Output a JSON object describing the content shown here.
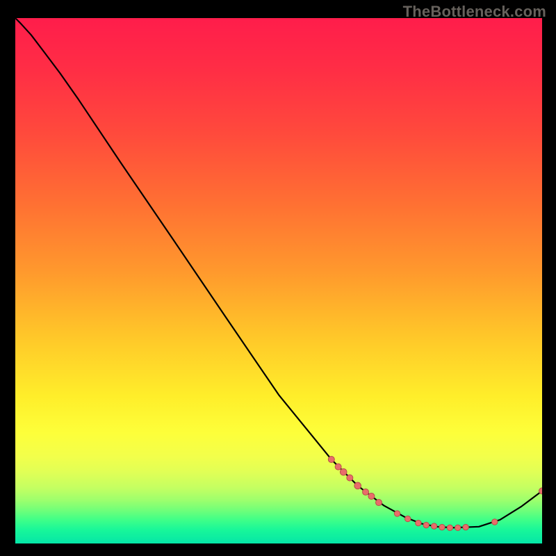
{
  "watermark": "TheBottleneck.com",
  "colors": {
    "marker_fill": "#e86d6a",
    "marker_stroke": "#b85049",
    "curve": "#000000"
  },
  "chart_data": {
    "type": "line",
    "title": "",
    "xlabel": "",
    "ylabel": "",
    "xlim": [
      0,
      100
    ],
    "ylim": [
      0,
      100
    ],
    "gradient_stops": [
      {
        "offset": 0.0,
        "color": "#ff1d4b"
      },
      {
        "offset": 0.1,
        "color": "#ff2e45"
      },
      {
        "offset": 0.22,
        "color": "#ff4a3c"
      },
      {
        "offset": 0.35,
        "color": "#ff6f33"
      },
      {
        "offset": 0.48,
        "color": "#ff982d"
      },
      {
        "offset": 0.6,
        "color": "#ffc529"
      },
      {
        "offset": 0.72,
        "color": "#ffee2a"
      },
      {
        "offset": 0.79,
        "color": "#fdff3a"
      },
      {
        "offset": 0.835,
        "color": "#f2ff4b"
      },
      {
        "offset": 0.865,
        "color": "#e0ff56"
      },
      {
        "offset": 0.895,
        "color": "#c3ff62"
      },
      {
        "offset": 0.918,
        "color": "#9cff6d"
      },
      {
        "offset": 0.938,
        "color": "#6dff7a"
      },
      {
        "offset": 0.955,
        "color": "#3fff88"
      },
      {
        "offset": 0.975,
        "color": "#17f69a"
      },
      {
        "offset": 1.0,
        "color": "#05e6a7"
      }
    ],
    "curve": [
      {
        "x": 0.0,
        "y": 100.0
      },
      {
        "x": 1.0,
        "y": 99.0
      },
      {
        "x": 3.0,
        "y": 96.8
      },
      {
        "x": 5.5,
        "y": 93.5
      },
      {
        "x": 8.5,
        "y": 89.5
      },
      {
        "x": 12.0,
        "y": 84.5
      },
      {
        "x": 20.0,
        "y": 72.5
      },
      {
        "x": 30.0,
        "y": 57.8
      },
      {
        "x": 40.0,
        "y": 43.0
      },
      {
        "x": 50.0,
        "y": 28.3
      },
      {
        "x": 60.0,
        "y": 16.0
      },
      {
        "x": 65.0,
        "y": 11.0
      },
      {
        "x": 70.0,
        "y": 7.2
      },
      {
        "x": 74.0,
        "y": 5.0
      },
      {
        "x": 77.0,
        "y": 3.8
      },
      {
        "x": 80.0,
        "y": 3.2
      },
      {
        "x": 83.0,
        "y": 3.0
      },
      {
        "x": 88.0,
        "y": 3.2
      },
      {
        "x": 92.0,
        "y": 4.5
      },
      {
        "x": 96.0,
        "y": 7.0
      },
      {
        "x": 100.0,
        "y": 10.0
      }
    ],
    "markers": [
      {
        "x": 60.0,
        "y": 16.0,
        "r": 4.5
      },
      {
        "x": 61.3,
        "y": 14.6,
        "r": 4.5
      },
      {
        "x": 62.3,
        "y": 13.6,
        "r": 4.8
      },
      {
        "x": 63.5,
        "y": 12.5,
        "r": 4.5
      },
      {
        "x": 65.0,
        "y": 11.0,
        "r": 4.8
      },
      {
        "x": 66.5,
        "y": 9.8,
        "r": 4.5
      },
      {
        "x": 67.6,
        "y": 9.0,
        "r": 4.5
      },
      {
        "x": 69.0,
        "y": 7.8,
        "r": 4.5
      },
      {
        "x": 72.5,
        "y": 5.7,
        "r": 4.2
      },
      {
        "x": 74.5,
        "y": 4.7,
        "r": 4.2
      },
      {
        "x": 76.5,
        "y": 3.9,
        "r": 4.2
      },
      {
        "x": 78.0,
        "y": 3.5,
        "r": 4.2
      },
      {
        "x": 79.5,
        "y": 3.3,
        "r": 4.2
      },
      {
        "x": 81.0,
        "y": 3.1,
        "r": 4.2
      },
      {
        "x": 82.5,
        "y": 3.0,
        "r": 4.2
      },
      {
        "x": 84.0,
        "y": 3.0,
        "r": 4.2
      },
      {
        "x": 85.5,
        "y": 3.1,
        "r": 4.2
      },
      {
        "x": 91.0,
        "y": 4.1,
        "r": 4.2
      },
      {
        "x": 100.0,
        "y": 10.0,
        "r": 4.5
      }
    ]
  }
}
